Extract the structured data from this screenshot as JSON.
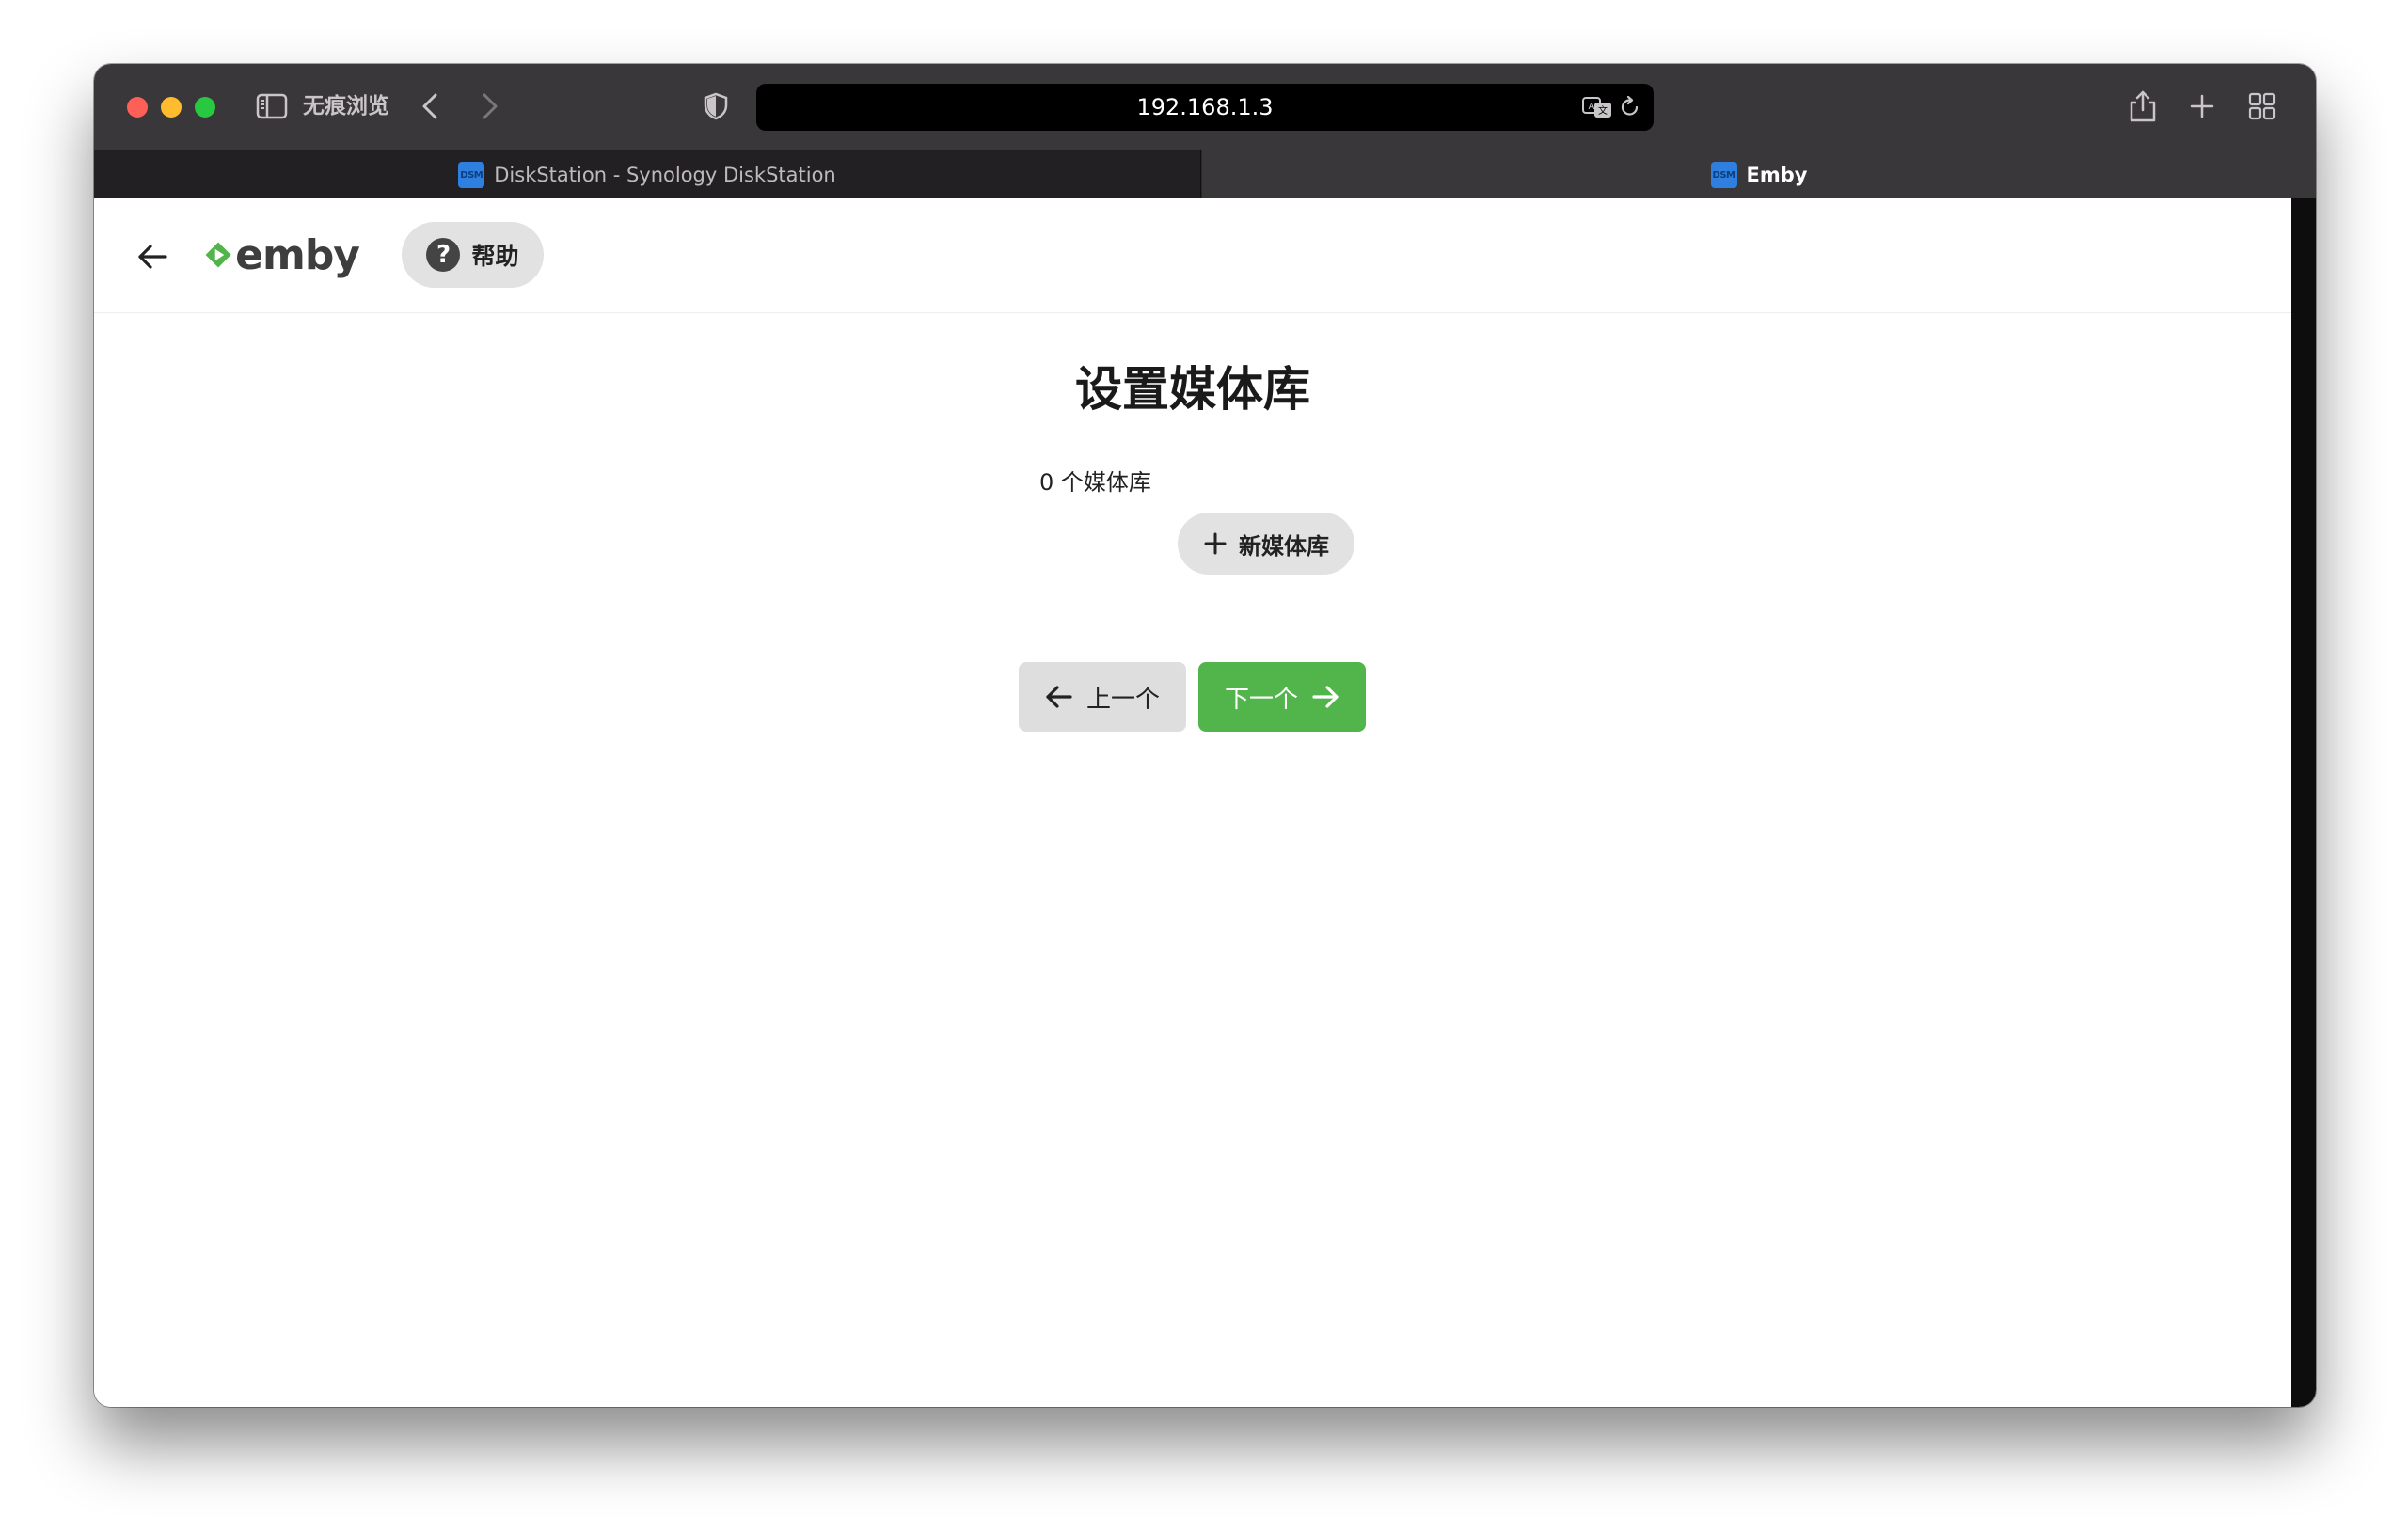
{
  "browser": {
    "private_label": "无痕浏览",
    "url": "192.168.1.3",
    "tabs": [
      {
        "title": "DiskStation - Synology DiskStation",
        "favicon": "DSM",
        "active": false
      },
      {
        "title": "Emby",
        "favicon": "DSM",
        "active": true
      }
    ]
  },
  "header": {
    "logo_text": "emby",
    "help_label": "帮助"
  },
  "main": {
    "title": "设置媒体库",
    "library_count": "0 个媒体库",
    "new_library_label": "新媒体库",
    "prev_label": "上一个",
    "next_label": "下一个"
  },
  "colors": {
    "accent_green": "#52b54b",
    "toolbar": "#3a373b",
    "button_gray": "#e2e2e2"
  },
  "icons": [
    "sidebar-icon",
    "chevron-left-icon",
    "chevron-right-icon",
    "shield-icon",
    "translate-icon",
    "reload-icon",
    "share-icon",
    "plus-icon",
    "tab-overview-icon",
    "arrow-left-icon",
    "emby-logo-icon",
    "help-icon",
    "arrow-right-icon"
  ]
}
